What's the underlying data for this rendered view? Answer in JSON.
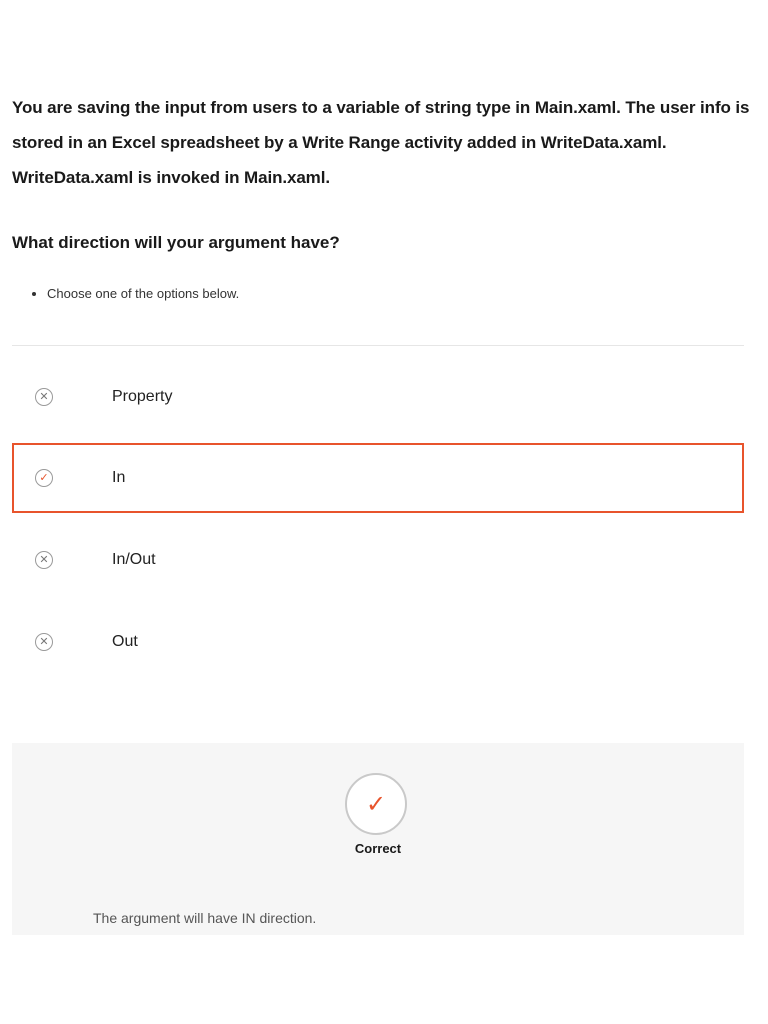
{
  "question": {
    "text": "You are saving the input from users to a variable of string type in Main.xaml.  The user info is stored in an Excel spreadsheet by a Write Range activity added in WriteData.xaml. WriteData.xaml is invoked in Main.xaml.",
    "prompt": "What direction will your argument have?",
    "instructions": [
      "Choose one of the options below."
    ]
  },
  "options": [
    {
      "label": "Property",
      "state": "incorrect",
      "icon": "x-circle-icon"
    },
    {
      "label": "In",
      "state": "selected-correct",
      "icon": "check-circle-icon"
    },
    {
      "label": "In/Out",
      "state": "incorrect",
      "icon": "x-circle-icon"
    },
    {
      "label": "Out",
      "state": "incorrect",
      "icon": "x-circle-icon"
    }
  ],
  "feedback": {
    "status": "Correct",
    "icon": "check-icon",
    "explanation": "The argument will have IN direction."
  },
  "colors": {
    "accent": "#e8542c",
    "feedback_bg": "#f6f6f6",
    "divider": "#e6e6e6"
  }
}
